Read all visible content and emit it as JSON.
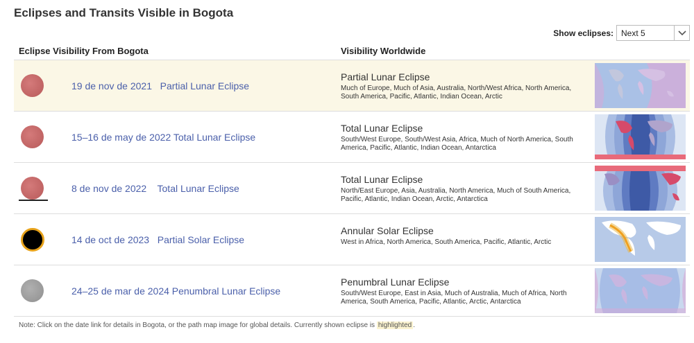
{
  "title": "Eclipses and Transits Visible in Bogota",
  "show_eclipses": {
    "label": "Show eclipses:",
    "value": "Next 5"
  },
  "headers": {
    "left": "Eclipse Visibility From Bogota",
    "right": "Visibility Worldwide"
  },
  "rows": [
    {
      "icon": "partial-lunar-moon-icon",
      "link": "19 de nov de 2021   Partial Lunar Eclipse",
      "type": "Partial Lunar Eclipse",
      "regions": "Much of Europe, Much of Asia, Australia, North/West Africa, North America, South America, Pacific, Atlantic, Indian Ocean, Arctic",
      "highlighted": true
    },
    {
      "icon": "total-lunar-moon-icon",
      "link": "15–16 de may de 2022 Total Lunar Eclipse",
      "type": "Total Lunar Eclipse",
      "regions": "South/West Europe, South/West Asia, Africa, Much of North America, South America, Pacific, Atlantic, Indian Ocean, Antarctica",
      "highlighted": false
    },
    {
      "icon": "total-lunar-moon-horizon-icon",
      "link": "8 de nov de 2022    Total Lunar Eclipse",
      "type": "Total Lunar Eclipse",
      "regions": "North/East Europe, Asia, Australia, North America, Much of South America, Pacific, Atlantic, Indian Ocean, Arctic, Antarctica",
      "highlighted": false
    },
    {
      "icon": "solar-eclipse-icon",
      "link": "14 de oct de 2023   Partial Solar Eclipse",
      "type": "Annular Solar Eclipse",
      "regions": "West in Africa, North America, South America, Pacific, Atlantic, Arctic",
      "highlighted": false
    },
    {
      "icon": "penumbral-lunar-moon-icon",
      "link": "24–25 de mar de 2024 Penumbral Lunar Eclipse",
      "type": "Penumbral Lunar Eclipse",
      "regions": "South/West Europe, East in Asia, Much of Australia, Much of Africa, North America, South America, Pacific, Atlantic, Arctic, Antarctica",
      "highlighted": false
    }
  ],
  "note": {
    "text": "Note: Click on the date link for details in Bogota, or the path map image for global details. Currently shown eclipse is",
    "highlight": "highlighted",
    "end": "."
  },
  "colors": {
    "link": "#4a5faa",
    "highlight_bg": "#fbf7e6",
    "moon_red": "#c06565",
    "moon_grey": "#a0a0a0",
    "sun_ring": "#e7a21a"
  }
}
